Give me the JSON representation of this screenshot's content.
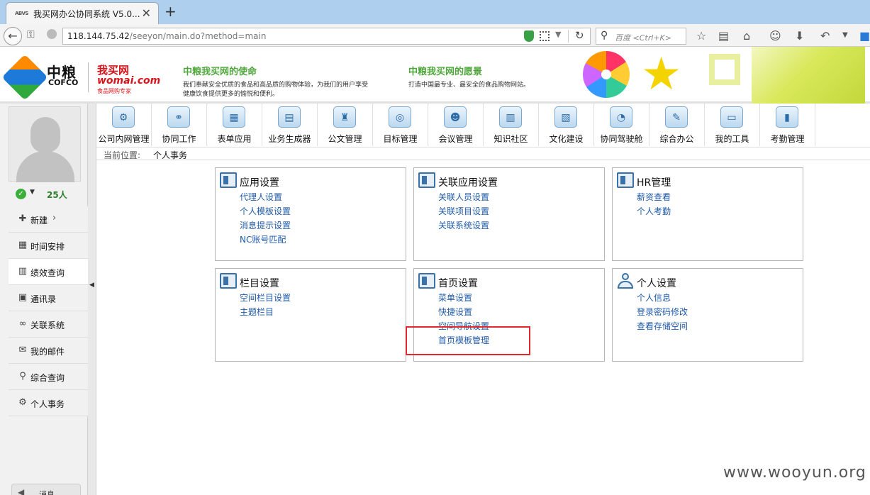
{
  "browser": {
    "tab_favicon_text": "ABVS",
    "tab_title": "我买网办公协同系统 V5.0...",
    "tab_close": "✕",
    "new_tab": "+",
    "url_host": "118.144.75.42",
    "url_path": "/seeyon/main.do?method=main",
    "search_placeholder": "百度 <Ctrl+K>"
  },
  "banner": {
    "cofco_cn": "中粮",
    "cofco_en": "COFCO",
    "womai_cn": "我买网",
    "womai_en": "womai.com",
    "womai_sub": "食品网购专家",
    "mission_title": "中粮我买网的使命",
    "mission_line1": "我们奉献安全优质的食品和高品质的购物体验，为我们的用户享受",
    "mission_line2": "健康饮食提供更多的愉悦和便利。",
    "vision_title": "中粮我买网的愿景",
    "vision_line1": "打造中国最专业、最安全的食品购物网站。"
  },
  "sidebar": {
    "online_count": "25人",
    "items": [
      {
        "label": "新建",
        "icon": "plus-icon"
      },
      {
        "label": "时间安排",
        "icon": "calendar-icon"
      },
      {
        "label": "绩效查询",
        "icon": "chart-icon"
      },
      {
        "label": "通讯录",
        "icon": "contact-icon"
      },
      {
        "label": "关联系统",
        "icon": "link-icon"
      },
      {
        "label": "我的邮件",
        "icon": "mail-icon"
      },
      {
        "label": "综合查询",
        "icon": "search-icon"
      },
      {
        "label": "个人事务",
        "icon": "gear-icon"
      }
    ],
    "sound_label": "消息"
  },
  "appnav": {
    "items": [
      {
        "label": "公司内网管理",
        "icon": "intranet-icon"
      },
      {
        "label": "协同工作",
        "icon": "collab-icon"
      },
      {
        "label": "表单应用",
        "icon": "form-icon"
      },
      {
        "label": "业务生成器",
        "icon": "generator-icon"
      },
      {
        "label": "公文管理",
        "icon": "stamp-icon"
      },
      {
        "label": "目标管理",
        "icon": "target-icon"
      },
      {
        "label": "会议管理",
        "icon": "meeting-icon"
      },
      {
        "label": "知识社区",
        "icon": "book-icon"
      },
      {
        "label": "文化建设",
        "icon": "culture-icon"
      },
      {
        "label": "协同驾驶舱",
        "icon": "dashboard-icon"
      },
      {
        "label": "综合办公",
        "icon": "office-icon"
      },
      {
        "label": "我的工具",
        "icon": "toolbox-icon"
      },
      {
        "label": "考勤管理",
        "icon": "attendance-icon"
      }
    ]
  },
  "breadcrumb": {
    "label": "当前位置:",
    "value": "个人事务"
  },
  "panels": [
    {
      "title": "应用设置",
      "icon": "app-settings-icon",
      "links": [
        "代理人设置",
        "个人模板设置",
        "消息提示设置",
        "NC账号匹配"
      ]
    },
    {
      "title": "关联应用设置",
      "icon": "related-app-icon",
      "links": [
        "关联人员设置",
        "关联项目设置",
        "关联系统设置"
      ]
    },
    {
      "title": "HR管理",
      "icon": "hr-icon",
      "links": [
        "薪资查看",
        "个人考勤"
      ]
    },
    {
      "title": "栏目设置",
      "icon": "column-settings-icon",
      "links": [
        "空间栏目设置",
        "主题栏目"
      ]
    },
    {
      "title": "首页设置",
      "icon": "homepage-settings-icon",
      "links": [
        "菜单设置",
        "快捷设置",
        "空间导航设置",
        "首页模板管理"
      ]
    },
    {
      "title": "个人设置",
      "icon": "person-icon",
      "links": [
        "个人信息",
        "登录密码修改",
        "查看存储空间"
      ]
    }
  ],
  "watermark": "www.wooyun.org"
}
